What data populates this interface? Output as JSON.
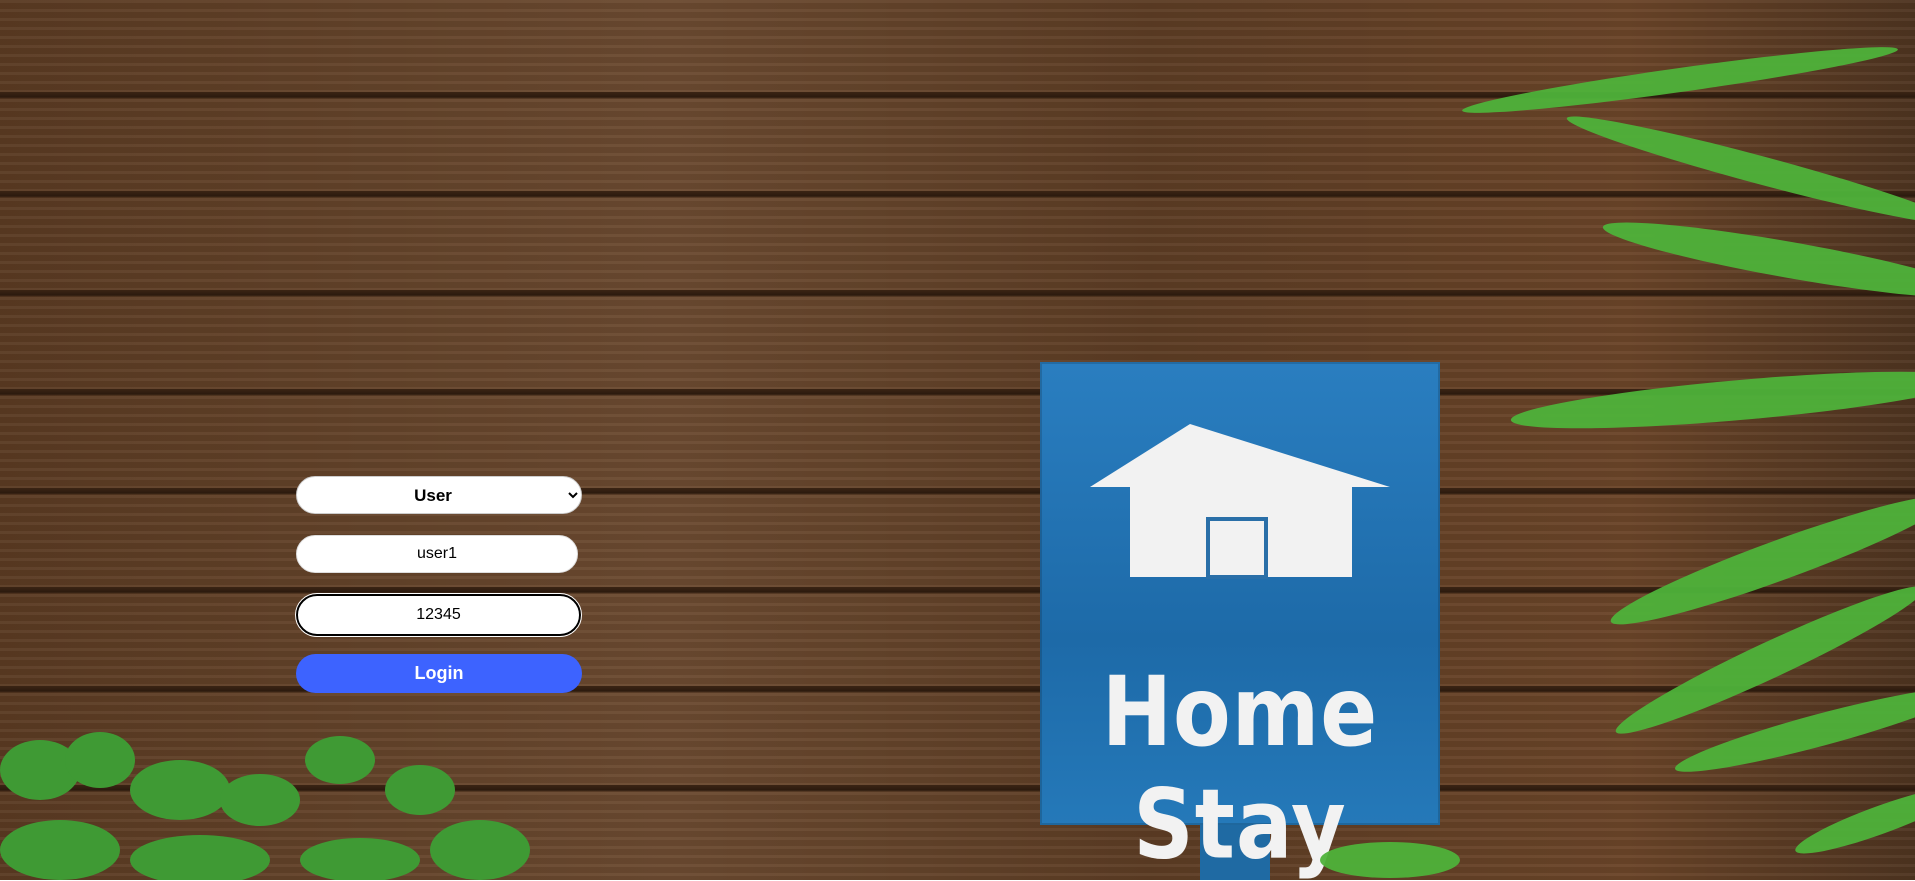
{
  "background": {
    "sign_text": "Home Stay"
  },
  "form": {
    "role_select": {
      "selected": "User",
      "options": [
        "User"
      ]
    },
    "username": {
      "value": "user1"
    },
    "password": {
      "value": "12345"
    },
    "login_label": "Login"
  },
  "colors": {
    "login_button": "#3d63ff",
    "sign_blue": "#1d6aa8"
  }
}
